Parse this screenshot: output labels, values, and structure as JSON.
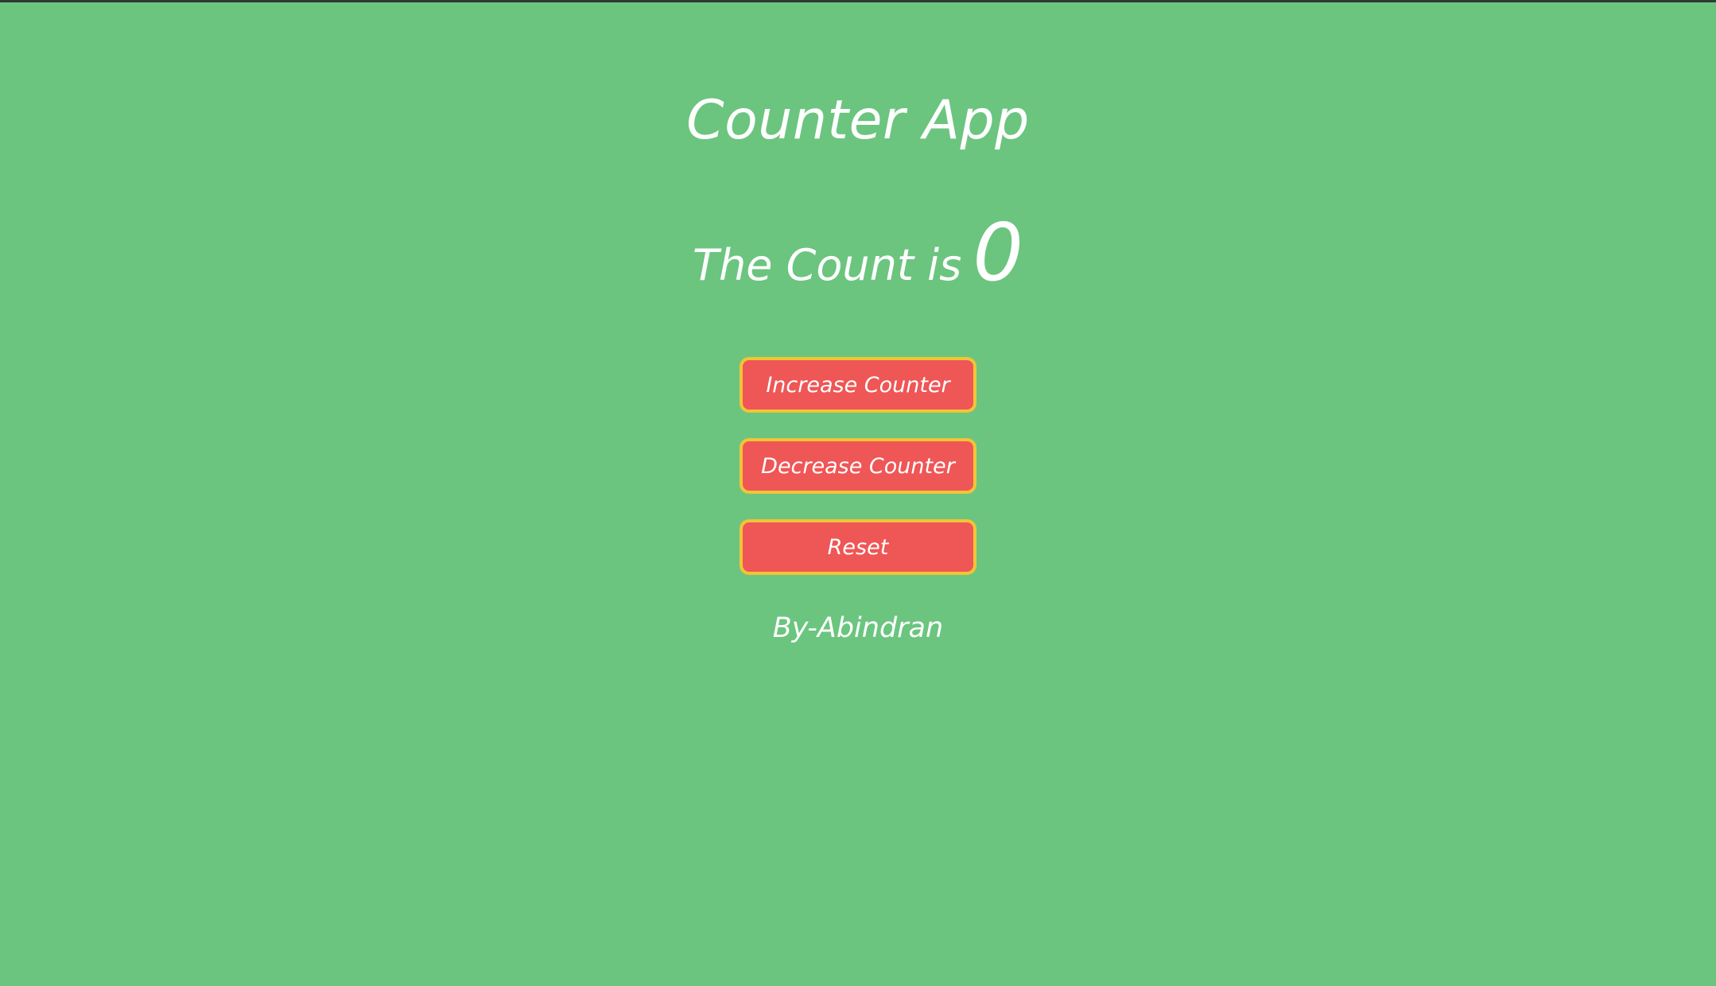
{
  "app": {
    "title": "Counter App",
    "count_label": "The Count is",
    "count_value": "0",
    "buttons": {
      "increase": "Increase Counter",
      "decrease": "Decrease Counter",
      "reset": "Reset"
    },
    "author": "By-Abindran"
  },
  "colors": {
    "background": "#6bc57f",
    "button_fill": "#ef5656",
    "button_border": "#f2c436",
    "text": "#ffffff"
  }
}
